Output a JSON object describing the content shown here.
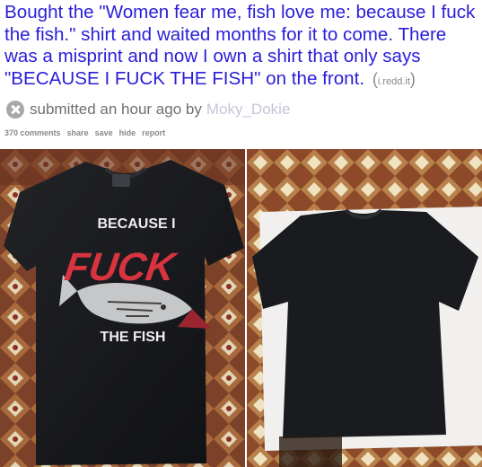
{
  "post": {
    "title": "Bought the \"Women fear me, fish love me: because I fuck the fish.\" shirt and waited months for it to come. There was a misprint and now I own a shirt that only says \"BECAUSE I FUCK THE FISH\" on the front.",
    "domain": "i.redd.it",
    "tagline_prefix": "submitted an hour ago by",
    "author": "Moky_Dokie",
    "actions": {
      "comments": "370 comments",
      "share": "share",
      "save": "save",
      "hide": "hide",
      "report": "report"
    }
  },
  "shirt_print": {
    "line1": "BECAUSE I",
    "line2": "FUCK",
    "line3": "THE FISH"
  },
  "colors": {
    "title_link": "#2b1ed8",
    "muted": "#888888",
    "shirt": "#16171a",
    "print_red": "#d8343f",
    "floor": "#8a4a2a"
  }
}
